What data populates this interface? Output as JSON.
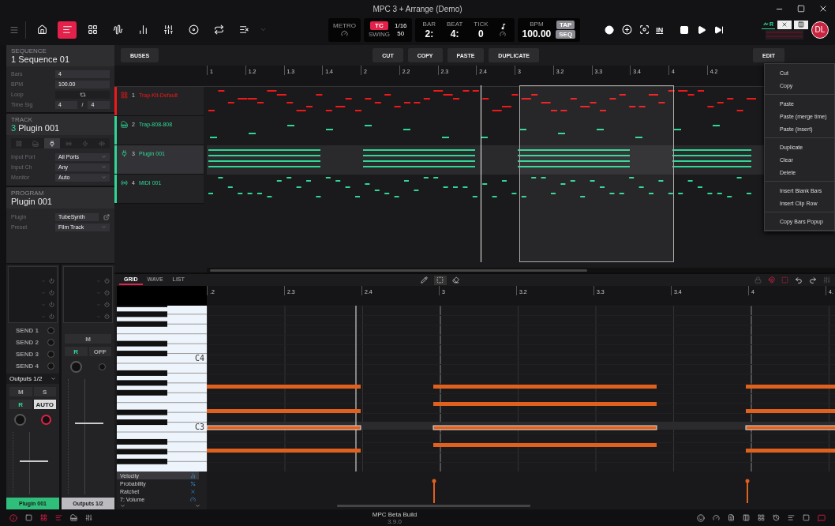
{
  "window": {
    "title": "MPC 3 + Arrange (Demo)"
  },
  "toolbar": {
    "modes": [
      {
        "kind": "home",
        "selected": false
      },
      {
        "kind": "arrange",
        "selected": true
      },
      {
        "kind": "pads",
        "selected": false
      },
      {
        "kind": "sample",
        "selected": false
      },
      {
        "kind": "steps",
        "selected": false
      },
      {
        "kind": "mixer",
        "selected": false
      },
      {
        "kind": "disc",
        "selected": false
      },
      {
        "kind": "looper",
        "selected": false
      },
      {
        "kind": "clear",
        "selected": false
      }
    ]
  },
  "transport": {
    "metro_label": "METRO",
    "tc": "TC",
    "tc_value": "1/16",
    "swing_label": "SWING",
    "swing_value": "50",
    "bar_label": "BAR",
    "bar": "2:",
    "beat_label": "BEAT",
    "beat": "4:",
    "tick_label": "TICK",
    "tick": "0",
    "bpm_label": "BPM",
    "bpm": "100.00",
    "tap": "TAP",
    "seq": "SEQ",
    "input_label": "IN",
    "rec_source": "R",
    "user_initials": "DL"
  },
  "sequence": {
    "header": "SEQUENCE",
    "name": "1 Sequence 01",
    "fields": [
      {
        "label": "Bars",
        "value": "4",
        "kind": "text"
      },
      {
        "label": "BPM",
        "value": "100.00",
        "kind": "text"
      },
      {
        "label": "Loop",
        "kind": "loop"
      },
      {
        "label": "Time Sig",
        "value": "4",
        "value2": "4",
        "separator": "/",
        "kind": "timesig"
      }
    ]
  },
  "track": {
    "header": "TRACK",
    "number": "3",
    "name": "Plugin 001",
    "types": [
      {
        "kind": "drum",
        "selected": false
      },
      {
        "kind": "keygroup",
        "selected": false
      },
      {
        "kind": "plugin",
        "selected": true
      },
      {
        "kind": "midi",
        "selected": false
      },
      {
        "kind": "clip",
        "selected": false
      },
      {
        "kind": "audio",
        "selected": false
      }
    ],
    "fields": [
      {
        "label": "Input Port",
        "value": "All Ports"
      },
      {
        "label": "Input Ch",
        "value": "Any"
      },
      {
        "label": "Monitor",
        "value": "Auto"
      }
    ]
  },
  "program": {
    "header": "PROGRAM",
    "name": "Plugin 001",
    "plugin_label": "Plugin",
    "plugin": "TubeSynth",
    "preset_label": "Preset",
    "preset": "Film Track"
  },
  "mixer": {
    "strips": [
      {
        "sends": [
          "SEND 1",
          "SEND 2",
          "SEND 3",
          "SEND 4"
        ],
        "output": "Outputs 1/2",
        "mute": "M",
        "solo": "S",
        "read": "R",
        "auto": "AUTO",
        "fader": {
          "level": 0.55
        },
        "name": "Plugin 001",
        "selected": true
      },
      {
        "mute": "M",
        "read": "R",
        "auto": "OFF",
        "fader": {
          "level": 0.62
        },
        "name": "Outputs 1/2",
        "selected": false
      }
    ]
  },
  "arrange": {
    "buttons": [
      "BUSES",
      "CUT",
      "COPY",
      "PASTE",
      "DUPLICATE"
    ],
    "edit": "EDIT",
    "ruler": [
      "1",
      "1.2",
      "1.3",
      "1.4",
      "2",
      "2.2",
      "2.3",
      "2.4",
      "3",
      "3.2",
      "3.3",
      "3.4",
      "4",
      "4.2"
    ],
    "tracks": [
      {
        "number": "1",
        "name": "Trap-Kit-Default",
        "kind": "drum",
        "color": "#f01818",
        "selected": false
      },
      {
        "number": "2",
        "name": "Trap-808-808",
        "kind": "keygroup",
        "color": "#2fd694",
        "selected": false
      },
      {
        "number": "3",
        "name": "Plugin 001",
        "kind": "plugin",
        "color": "#2fd694",
        "selected": true
      },
      {
        "number": "4",
        "name": "MIDI 001",
        "kind": "midi",
        "color": "#2fd694",
        "selected": false
      }
    ]
  },
  "edit_menu": {
    "groups": [
      [
        "Cut",
        "Copy"
      ],
      [
        "Paste",
        "Paste (merge time)",
        "Paste (insert)"
      ],
      [
        "Duplicate",
        "Clear",
        "Delete"
      ],
      [
        "Insert Blank Bars",
        "Insert Clip Row"
      ],
      [
        "Copy Bars Popup"
      ]
    ]
  },
  "editor": {
    "tabs": [
      {
        "label": "GRID",
        "selected": true
      },
      {
        "label": "WAVE",
        "selected": false
      },
      {
        "label": "LIST",
        "selected": false
      }
    ],
    "tools": [
      {
        "kind": "pencil",
        "selected": false
      },
      {
        "kind": "select",
        "selected": true
      },
      {
        "kind": "eraser",
        "selected": false
      }
    ],
    "ruler": [
      ".2",
      "2.3",
      "2.4",
      "3",
      "3.2",
      "3.3",
      "3.4",
      "4",
      "4."
    ],
    "key_labels": [
      "C4",
      "C3"
    ],
    "lanes": [
      {
        "label": "Velocity",
        "kind": "velocity",
        "selected": true
      },
      {
        "label": "Probability",
        "kind": "probability",
        "selected": false
      },
      {
        "label": "Ratchet",
        "kind": "ratchet",
        "selected": false
      },
      {
        "label": "7: Volume",
        "kind": "volume",
        "selected": false
      }
    ]
  },
  "status_bar": {
    "build": "MPC Beta Build",
    "version": "3.9.0"
  }
}
